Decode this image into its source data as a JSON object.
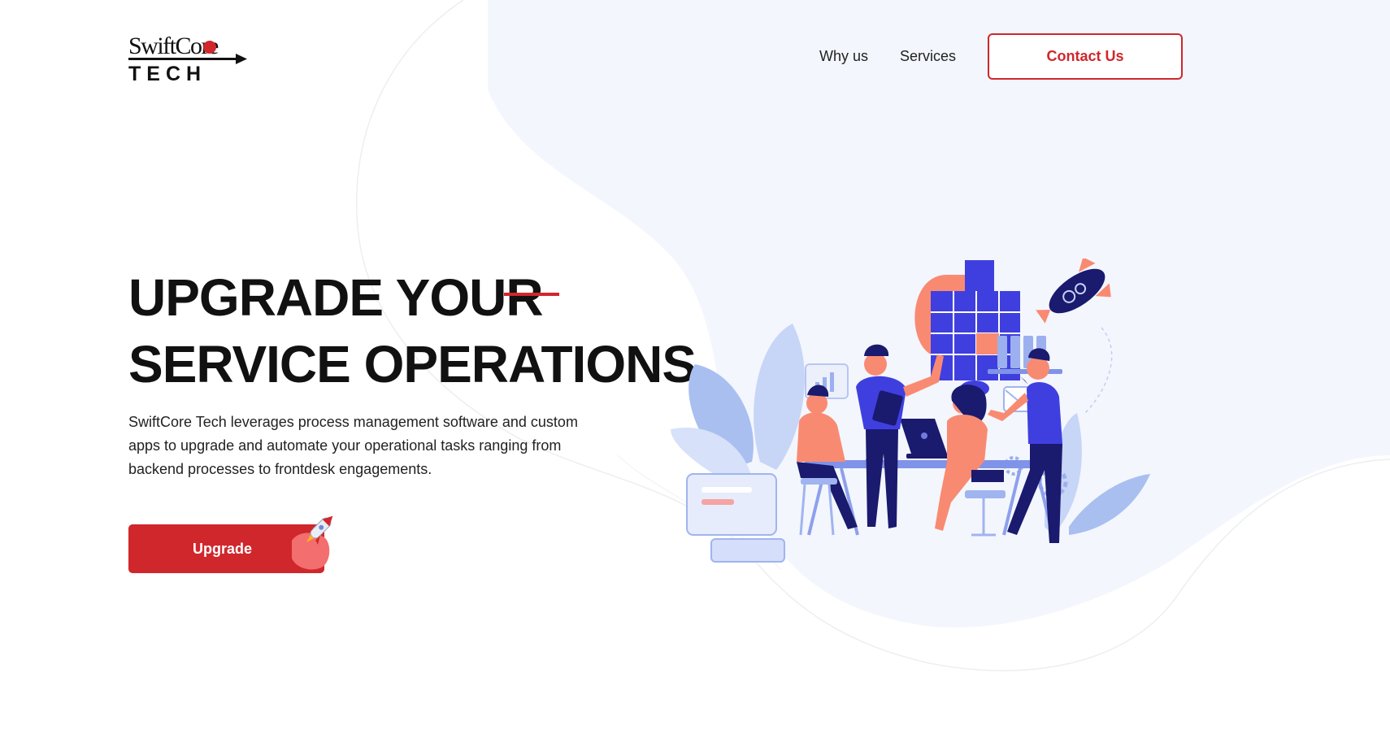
{
  "header": {
    "logo": {
      "line1": "SwiftCore",
      "line2": "TECH"
    },
    "nav": [
      {
        "label": "Why us"
      },
      {
        "label": "Services"
      }
    ],
    "contact_label": "Contact Us"
  },
  "hero": {
    "title_line1": "UPGRADE YOUR",
    "title_line2": "SERVICE OPERATIONS",
    "description": "SwiftCore Tech leverages process management software and custom apps to upgrade and automate your operational tasks ranging from backend processes to frontdesk engagements.",
    "cta_label": "Upgrade"
  },
  "colors": {
    "accent": "#d0272c",
    "background_blob": "#f3f6fd",
    "illustration_blue": "#3f3fe0",
    "illustration_navy": "#1a1a6e",
    "illustration_peach": "#f98a72"
  },
  "icons": [
    "rocket-icon",
    "puzzle-icon",
    "gear-icon",
    "mail-icon",
    "bar-chart-icon",
    "laptop-icon"
  ]
}
